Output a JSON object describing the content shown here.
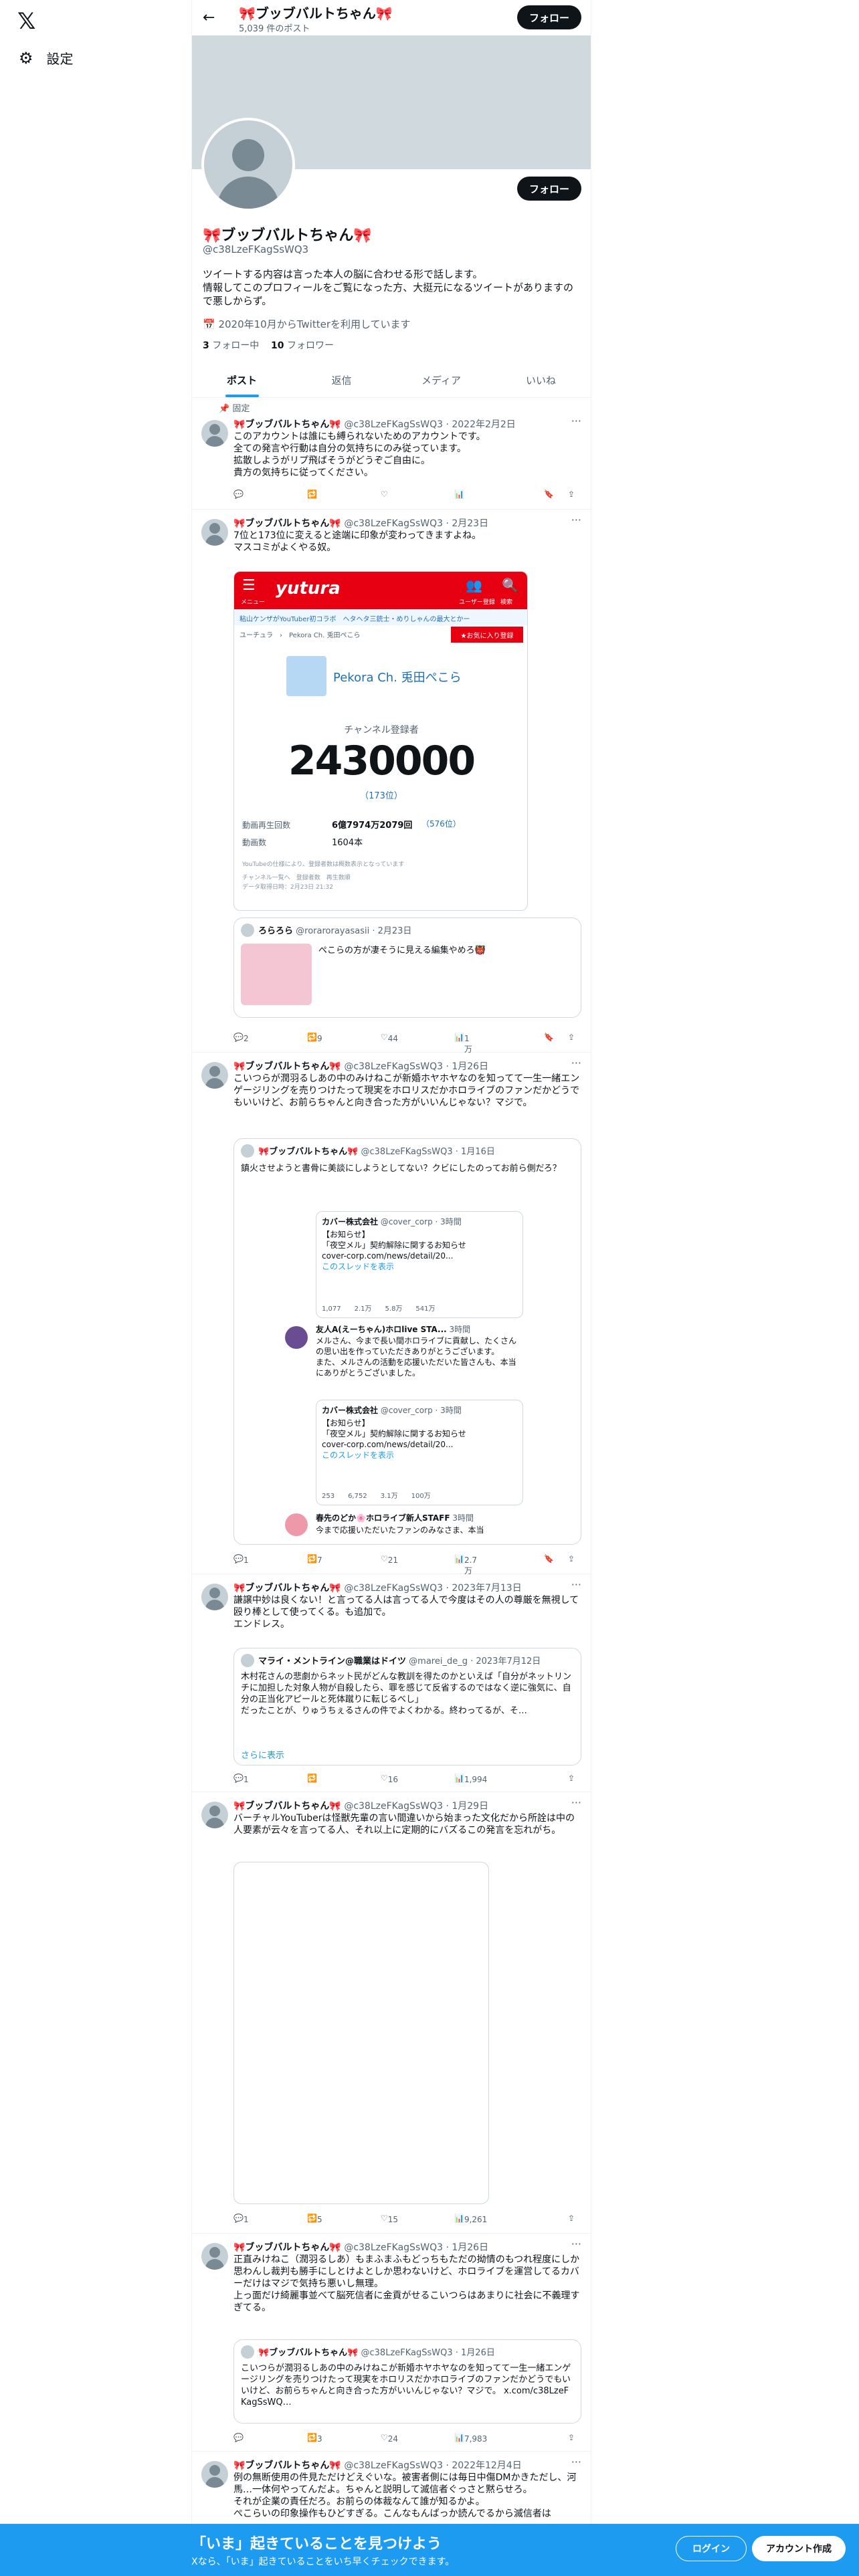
{
  "nav": {
    "settings_label": "設定"
  },
  "header": {
    "name": "🎀ブッブバルトちゃん🎀",
    "post_count": "5,039 件のポスト",
    "follow_label": "フォロー"
  },
  "profile": {
    "name": "🎀ブッブバルトちゃん🎀",
    "handle": "@c38LzeFKagSsWQ3",
    "bio1": "ツイートする内容は言った本人の脳に合わせる形で話します。",
    "bio2": "情報してこのプロフィールをご覧になった方、大挺元になるツイートがありますので悪しからず。",
    "joined": "2020年10月からTwitterを利用しています",
    "following_count": "3",
    "following_label": "フォロー中",
    "followers_count": "10",
    "followers_label": "フォロワー",
    "follow_label": "フォロー"
  },
  "tabs": [
    "ポスト",
    "返信",
    "メディア",
    "いいね"
  ],
  "pinned_label": "固定",
  "tweets": [
    {
      "name": "🎀ブッブバルトちゃん🎀",
      "meta": "@c38LzeFKagSsWQ3 · 2022年2月2日",
      "text": "このアカウントは誰にも縛られないためのアカウントです。\n全ての発言や行動は自分の気持ちにのみ従っています。\n拡散しようがリプ飛ばそうがどうぞご自由に。\n貴方の気持ちに従ってください。",
      "reply": "",
      "rt": "",
      "like": "",
      "views": ""
    },
    {
      "name": "🎀ブッブバルトちゃん🎀",
      "meta": "@c38LzeFKagSsWQ3 · 2月23日",
      "text": "7位と173位に変えると途端に印象が変わってきますよね。\nマスコミがよくやる奴。",
      "reply": "2",
      "rt": "9",
      "like": "44",
      "views": "1万"
    },
    {
      "name": "🎀ブッブバルトちゃん🎀",
      "meta": "@c38LzeFKagSsWQ3 · 1月26日",
      "text": "こいつらが潤羽るしあの中のみけねこが新婚ホヤホヤなのを知ってて一生一緒エンゲージリングを売りつけたって現実をホロリスだかホロライブのファンだかどうでもいいけど、お前らちゃんと向き合った方がいいんじゃない？マジで。",
      "reply": "1",
      "rt": "7",
      "like": "21",
      "views": "2.7万"
    },
    {
      "name": "🎀ブッブバルトちゃん🎀",
      "meta": "@c38LzeFKagSsWQ3 · 2023年7月13日",
      "text": "謙譲中妙は良くない！と言ってる人は言ってる人で今度はその人の尊厳を無視して殴り棒として使ってくる。も追加で。\nエンドレス。",
      "reply": "1",
      "rt": "",
      "like": "16",
      "views": "1,994"
    },
    {
      "name": "🎀ブッブバルトちゃん🎀",
      "meta": "@c38LzeFKagSsWQ3 · 1月29日",
      "text": "バーチャルYouTuberは怪獣先輩の言い間違いから始まった文化だから所詮は中の人要素が云々を言ってる人、それ以上に定期的にバズるこの発言を忘れがち。",
      "reply": "1",
      "rt": "5",
      "like": "15",
      "views": "9,261"
    },
    {
      "name": "🎀ブッブバルトちゃん🎀",
      "meta": "@c38LzeFKagSsWQ3 · 1月26日",
      "text": "正直みけねこ（潤羽るしあ）もまふまふもどっちもただの拗情のもつれ程度にしか思わんし裁判も勝手にしとけよとしか思わないけど、ホロライブを運営してるカバーだけはマジで気持ち悪いし無理。\n上っ面だけ綺麗事並べて脳死信者に金貢がせるこいつらはあまりに社会に不義理すぎてる。",
      "reply": "",
      "rt": "3",
      "like": "24",
      "views": "7,983"
    },
    {
      "name": "🎀ブッブバルトちゃん🎀",
      "meta": "@c38LzeFKagSsWQ3 · 2022年12月4日",
      "text": "例の無断使用の件見ただけどえぐいな。被害者側には毎日中傷DMかきただし、河馬…一体何やってんだよ。ちゃんと説明して滅信者ぐっさと黙らせろ。\nそれが企業の責任だろ。お前らの体裁なんて誰が知るかよ。\nぺこらいの印象操作もひどすぎる。こんなもんばっか読んでるから滅信者は",
      "reply": "",
      "rt": "",
      "like": "",
      "views": ""
    }
  ],
  "yutura": {
    "logo": "yutura",
    "links": "粘山ケンザがYouTuber初コラボ　ヘタヘタ三銃士・めりしゃんの最大とかー",
    "crumb": "ユーチュラ　›　Pekora Ch. 兎田ぺこら",
    "fav": "★お気に入り登録",
    "channel": "Pekora Ch. 兎田ぺこら",
    "subs_label": "チャンネル登録者",
    "subs": "2430000",
    "rank": "（173位）",
    "views_label": "動画再生回数",
    "views": "6億7974万2079回",
    "views_rank": "（576位）",
    "videos_label": "動画数",
    "videos": "1604本",
    "note": "YouTubeの仕様により、登録者数は概数表示となっています",
    "note2": "チャンネル一覧へ　登録者数　再生数順",
    "note3": "データ取得日時：2月23日 21:32",
    "user": "ユーザー登録",
    "search": "検索",
    "menu": "メニュー"
  },
  "quote1": {
    "name": "ろらろら",
    "meta": "@rorarorayasasii · 2月23日",
    "text": "ぺこらの方が凄そうに見える編集やめろ👹"
  },
  "quote2": {
    "name": "🎀ブッブバルトちゃん🎀",
    "meta": "@c38LzeFKagSsWQ3 · 1月16日",
    "text": "鎮火させようと書骨に美談にしようとしてない？クビにしたのってお前ら側だろ？"
  },
  "cover1": {
    "name": "カバー株式会社",
    "meta": "@cover_corp · 3時間",
    "l1": "【お知らせ】",
    "l2": "「夜空メル」契約解除に関するお知らせ",
    "l3": "cover-corp.com/news/detail/20...",
    "l4": "このスレッドを表示",
    "stats": "1,077　　2.1万　　5.8万　　541万"
  },
  "reply1": {
    "name": "友人A(えーちゃん)ホロlive STA...",
    "meta": "3時間",
    "text": "メルさん、今まで長い間ホロライブに貢献し、たくさんの思い出を作っていただきありがとうございます。\nまた、メルさんの活動を応援いただいた皆さんも、本当にありがとうございました。"
  },
  "cover2": {
    "name": "カバー株式会社",
    "meta": "@cover_corp · 3時間",
    "l1": "【お知らせ】",
    "l2": "「夜空メル」契約解除に関するお知らせ",
    "l3": "cover-corp.com/news/detail/20...",
    "l4": "このスレッドを表示",
    "stats": "253　　6,752　　3.1万　　100万"
  },
  "reply2": {
    "name": "春先のどか🌸ホロライブ新人STAFF",
    "meta": "3時間",
    "text": "今まで応援いただいたファンのみなさま、本当"
  },
  "quote3": {
    "name": "マライ・メントライン@職業はドイツ",
    "meta": "@marei_de_g · 2023年7月12日",
    "text": "木村花さんの悲劇からネット民がどんな教訓を得たのかといえば「自分がネットリンチに加担した対象人物が自殺したら、罪を感じて反省するのではなく逆に強気に、自分の正当化アピールと死体蹴りに転じるべし」\nだったことが、りゅうちぇるさんの件でよくわかる。終わってるが、そ…",
    "more": "さらに表示"
  },
  "quote4": {
    "name": "🎀ブッブバルトちゃん🎀",
    "meta": "@c38LzeFKagSsWQ3 · 1月26日",
    "text": "こいつらが潤羽るしあの中のみけねこが新婚ホヤホヤなのを知ってて一生一緒エンゲージリングを売りつけたって現実をホロリスだかホロライブのファンだかどうでもいいけど、お前らちゃんと向き合った方がいいんじゃない？マジで。 x.com/c38LzeFKagSsWQ…"
  },
  "promo": {
    "title": "「いま」起きていることを見つけよう",
    "sub": "Xなら、「いま」起きていることをいち早くチェックできます。",
    "login": "ログイン",
    "signup": "アカウント作成"
  }
}
